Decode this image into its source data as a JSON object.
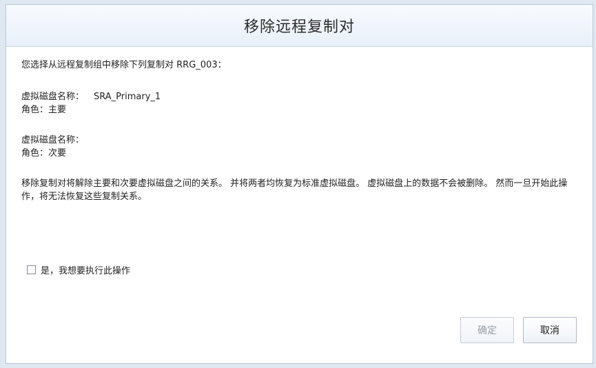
{
  "dialog": {
    "title": "移除远程复制对",
    "intro": "您选择从远程复制组中移除下列复制对 RRG_003：",
    "primary": {
      "disk_label": "虚拟磁盘名称：",
      "disk_value": "SRA_Primary_1",
      "role": "角色：主要"
    },
    "secondary": {
      "disk_label": "虚拟磁盘名称：",
      "disk_value": "",
      "role": "角色：次要"
    },
    "warning": "移除复制对将解除主要和次要虚拟磁盘之间的关系。 并将两者均恢复为标准虚拟磁盘。 虚拟磁盘上的数据不会被删除。 然而一旦开始此操作，将无法恢复这些复制关系。",
    "confirm_label": "是，我想要执行此操作",
    "confirm_checked": false,
    "ok_label": "确定",
    "cancel_label": "取消"
  },
  "colors": {
    "backdrop": "#dfe7f1",
    "title_bar": "#e9f0f9",
    "border": "#b9c7d8"
  }
}
